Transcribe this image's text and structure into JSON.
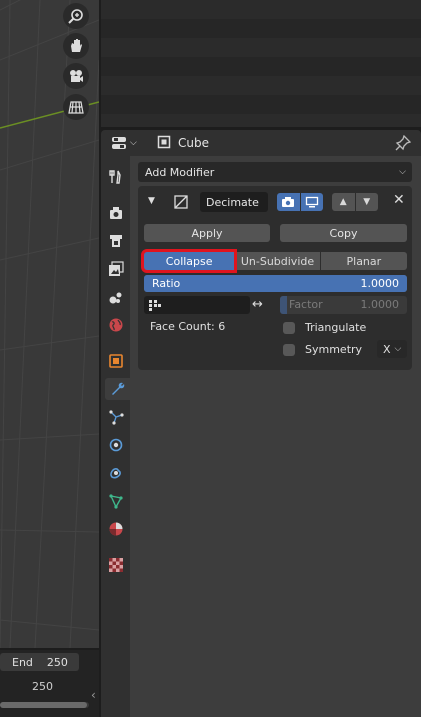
{
  "viewport": {
    "tools": [
      {
        "icon": "zoom-icon"
      },
      {
        "icon": "hand-pan-icon"
      },
      {
        "icon": "camera-view-icon"
      },
      {
        "icon": "perspective-grid-icon"
      }
    ]
  },
  "timeline": {
    "end_label": "End",
    "end_value": "250",
    "current_marker": "250"
  },
  "properties": {
    "object_name": "Cube",
    "add_modifier_label": "Add Modifier",
    "modifier": {
      "name": "Decimate",
      "apply_label": "Apply",
      "copy_label": "Copy",
      "modes": [
        "Collapse",
        "Un-Subdivide",
        "Planar"
      ],
      "active_mode": "Collapse",
      "ratio_label": "Ratio",
      "ratio_value": "1.0000",
      "ratio_fraction": 1.0,
      "factor_label": "Factor",
      "factor_value": "1.0000",
      "face_count_label": "Face Count: 6",
      "triangulate_label": "Triangulate",
      "symmetry_label": "Symmetry",
      "symmetry_axis": "X"
    },
    "tabs": [
      {
        "icon": "tool-icon"
      },
      {
        "icon": "render-icon"
      },
      {
        "icon": "output-icon"
      },
      {
        "icon": "view-layer-icon"
      },
      {
        "icon": "scene-icon"
      },
      {
        "icon": "world-icon"
      },
      {
        "icon": "object-icon"
      },
      {
        "icon": "modifier-wrench-icon"
      },
      {
        "icon": "particles-icon"
      },
      {
        "icon": "physics-icon"
      },
      {
        "icon": "constraints-icon"
      },
      {
        "icon": "object-data-icon"
      },
      {
        "icon": "material-icon"
      },
      {
        "icon": "texture-icon"
      }
    ],
    "active_tab": "modifier-wrench-icon"
  },
  "colors": {
    "accent_blue": "#4772b3",
    "highlight_red": "#e0141e",
    "panel_bg": "#3d3d3d"
  }
}
